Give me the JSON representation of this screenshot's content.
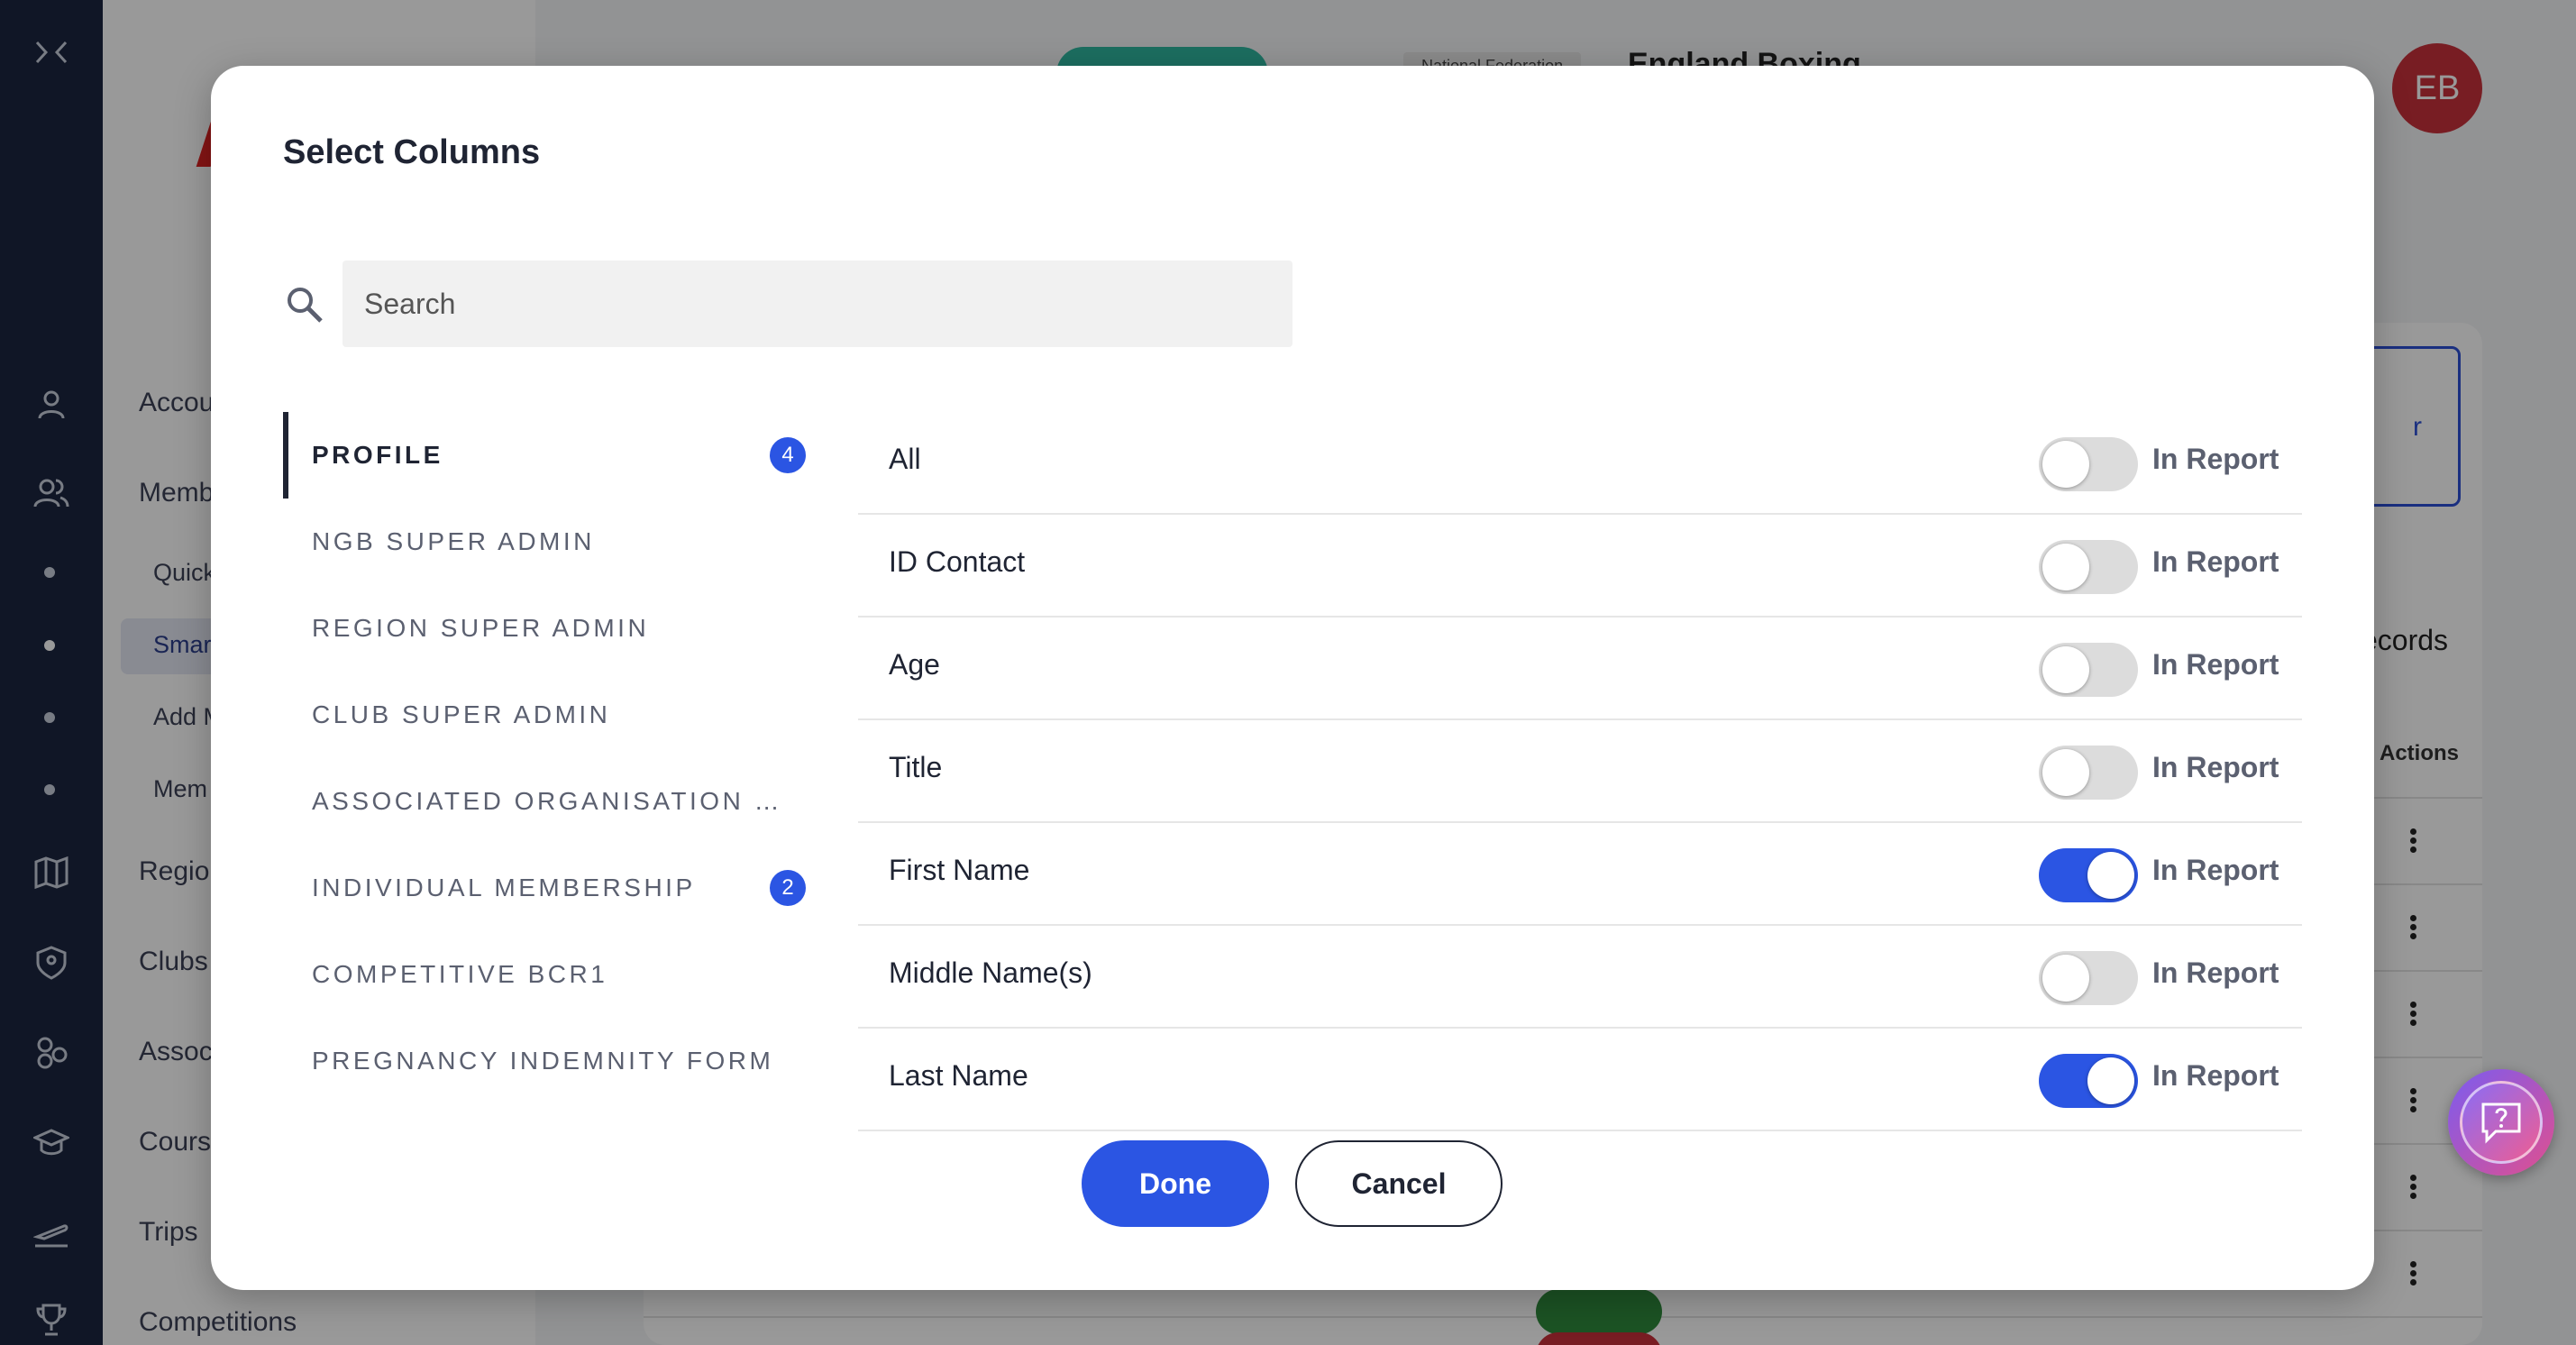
{
  "background": {
    "nav_items": [
      "Accou",
      "Memb",
      "Regio",
      "Clubs",
      "Assoc",
      "Cours",
      "Trips",
      "Competitions"
    ],
    "sub_items": [
      "Quick",
      "Smar",
      "Add M",
      "Mem"
    ],
    "org_tag": "National Federation",
    "org_name": "England Boxing",
    "avatar_initials": "EB",
    "outline_button_text": "r",
    "records_text": "ecords",
    "actions_header": "Actions"
  },
  "modal": {
    "title": "Select Columns",
    "search": {
      "placeholder": "Search",
      "value": ""
    },
    "categories": [
      {
        "label": "PROFILE",
        "badge": "4",
        "active": true
      },
      {
        "label": "NGB SUPER ADMIN",
        "badge": null,
        "active": false
      },
      {
        "label": "REGION SUPER ADMIN",
        "badge": null,
        "active": false
      },
      {
        "label": "CLUB SUPER ADMIN",
        "badge": null,
        "active": false
      },
      {
        "label": "ASSOCIATED ORGANISATION SUPER ADMIN",
        "badge": null,
        "active": false
      },
      {
        "label": "INDIVIDUAL MEMBERSHIP",
        "badge": "2",
        "active": false
      },
      {
        "label": "COMPETITIVE BCR1",
        "badge": null,
        "active": false
      },
      {
        "label": "PREGNANCY INDEMNITY FORM",
        "badge": null,
        "active": false
      }
    ],
    "columns": [
      {
        "name": "All",
        "in_report": false,
        "toggle_label": "In Report"
      },
      {
        "name": "ID Contact",
        "in_report": false,
        "toggle_label": "In Report"
      },
      {
        "name": "Age",
        "in_report": false,
        "toggle_label": "In Report"
      },
      {
        "name": "Title",
        "in_report": false,
        "toggle_label": "In Report"
      },
      {
        "name": "First Name",
        "in_report": true,
        "toggle_label": "In Report"
      },
      {
        "name": "Middle Name(s)",
        "in_report": false,
        "toggle_label": "In Report"
      },
      {
        "name": "Last Name",
        "in_report": true,
        "toggle_label": "In Report"
      }
    ],
    "done_label": "Done",
    "cancel_label": "Cancel"
  },
  "colors": {
    "accent": "#2b55e3",
    "rail": "#1c2540",
    "avatar": "#c8313b"
  }
}
